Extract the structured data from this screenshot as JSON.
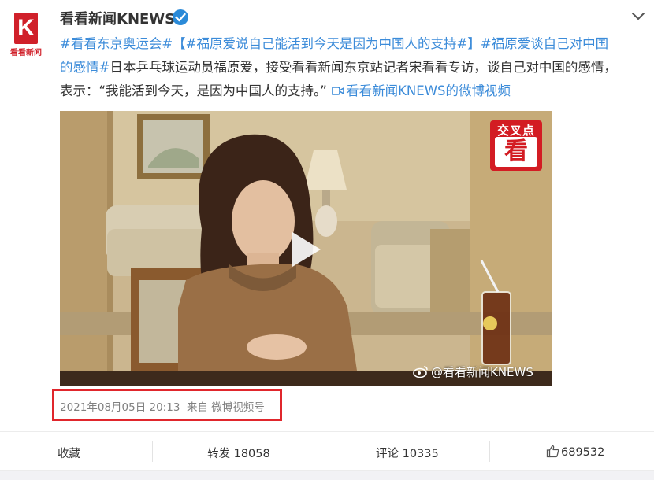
{
  "author": {
    "name": "看看新闻KNEWS",
    "avatar_letter": "K",
    "avatar_caption": "看看新闻",
    "verified": true
  },
  "post": {
    "tag1": "#看看东京奥运会#",
    "tag2": "【#福原爱说自己能活到今天是因为中国人的支持#】",
    "tag3_line1": "#福原爱谈自己对中国",
    "tag3_line2": "的感情#",
    "body_line2": "日本乒乓球运动员福原爱，接受看看新闻东京站记者宋看看专访，谈自己对中国的感情，",
    "body_line3": "表示：“我能活到今天，是因为中国人的支持。”",
    "video_link": "看看新闻KNEWS的微博视频"
  },
  "video": {
    "badge_top": "交叉点",
    "badge_bottom": "看",
    "watermark": "@看看新闻KNEWS"
  },
  "meta": {
    "timestamp": "2021年08月05日 20:13",
    "source": "来自 微博视频号"
  },
  "actions": {
    "favorite": "收藏",
    "repost": "转发 18058",
    "comment": "评论 10335",
    "like": "689532"
  },
  "colors": {
    "link": "#3b8bd9",
    "brand_red": "#d0202a",
    "highlight_box": "#e0262c",
    "verified": "#2a8ad8"
  },
  "icons": [
    "verified-icon",
    "chevron-down-icon",
    "video-link-icon",
    "play-icon",
    "weibo-logo-icon",
    "thumbs-up-icon"
  ]
}
